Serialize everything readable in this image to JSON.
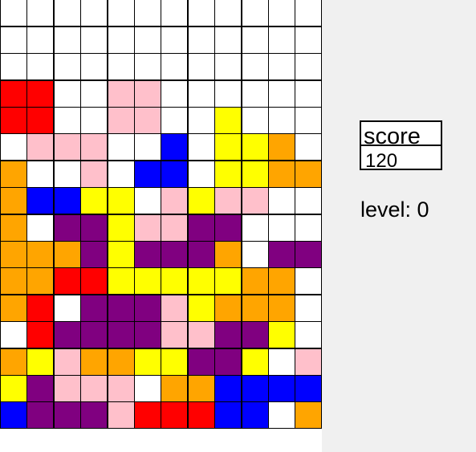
{
  "palette": {
    "_": "#ffffff",
    "R": "#ff0000",
    "P": "#ffc0cb",
    "Y": "#ffff00",
    "B": "#0000ff",
    "O": "#ffa500",
    "V": "#800080"
  },
  "board": {
    "columns": 12,
    "rows": [
      "____________",
      "____________",
      "____________",
      "____________",
      "RR__PP______",
      "RR__PP__Y___",
      "_PPP__B_YYO_",
      "O__P_BB_YYOO",
      "OBBYY_PYPP__",
      "O_VVYPPVV___",
      "OOOVYVVVO_VV",
      "OORRYYYYYOO_",
      "OR_VVVPYOOO_",
      "_RVVVVPPVVY_",
      "OYPOOYYVVY_P",
      "YVPPP_OOBBBB",
      "BVVVPRRRBB_O"
    ]
  },
  "score": {
    "label": "score",
    "value": "120"
  },
  "level": {
    "text": "level: 0"
  }
}
